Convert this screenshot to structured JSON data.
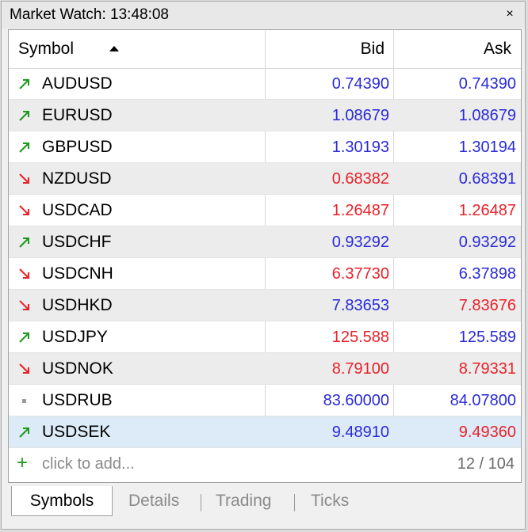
{
  "window": {
    "title": "Market Watch: 13:48:08",
    "close_label": "×"
  },
  "columns": {
    "symbol": "Symbol",
    "bid": "Bid",
    "ask": "Ask"
  },
  "rows": [
    {
      "symbol": "AUDUSD",
      "trend": "up",
      "bid": "0.74390",
      "ask": "0.74390",
      "bid_color": "blue",
      "ask_color": "blue"
    },
    {
      "symbol": "EURUSD",
      "trend": "up",
      "bid": "1.08679",
      "ask": "1.08679",
      "bid_color": "blue",
      "ask_color": "blue"
    },
    {
      "symbol": "GBPUSD",
      "trend": "up",
      "bid": "1.30193",
      "ask": "1.30194",
      "bid_color": "blue",
      "ask_color": "blue"
    },
    {
      "symbol": "NZDUSD",
      "trend": "down",
      "bid": "0.68382",
      "ask": "0.68391",
      "bid_color": "red",
      "ask_color": "blue"
    },
    {
      "symbol": "USDCAD",
      "trend": "down",
      "bid": "1.26487",
      "ask": "1.26487",
      "bid_color": "red",
      "ask_color": "red"
    },
    {
      "symbol": "USDCHF",
      "trend": "up",
      "bid": "0.93292",
      "ask": "0.93292",
      "bid_color": "blue",
      "ask_color": "blue"
    },
    {
      "symbol": "USDCNH",
      "trend": "down",
      "bid": "6.37730",
      "ask": "6.37898",
      "bid_color": "red",
      "ask_color": "blue"
    },
    {
      "symbol": "USDHKD",
      "trend": "down",
      "bid": "7.83653",
      "ask": "7.83676",
      "bid_color": "blue",
      "ask_color": "red"
    },
    {
      "symbol": "USDJPY",
      "trend": "up",
      "bid": "125.588",
      "ask": "125.589",
      "bid_color": "red",
      "ask_color": "blue"
    },
    {
      "symbol": "USDNOK",
      "trend": "down",
      "bid": "8.79100",
      "ask": "8.79331",
      "bid_color": "red",
      "ask_color": "red"
    },
    {
      "symbol": "USDRUB",
      "trend": "none",
      "bid": "83.60000",
      "ask": "84.07800",
      "bid_color": "blue",
      "ask_color": "blue"
    },
    {
      "symbol": "USDSEK",
      "trend": "up",
      "bid": "9.48910",
      "ask": "9.49360",
      "bid_color": "blue",
      "ask_color": "red"
    }
  ],
  "add_row": {
    "label": "click to add...",
    "count": "12 / 104"
  },
  "tabs": [
    {
      "label": "Symbols",
      "active": true
    },
    {
      "label": "Details",
      "active": false
    },
    {
      "label": "Trading",
      "active": false
    },
    {
      "label": "Ticks",
      "active": false
    }
  ],
  "colors": {
    "up_arrow": "#1d9a1d",
    "down_arrow": "#e8222a",
    "neutral_dot": "#9a9a9a",
    "blue": "#2a2ad8",
    "red": "#e8222a",
    "selected_row": "#dcebf7"
  }
}
